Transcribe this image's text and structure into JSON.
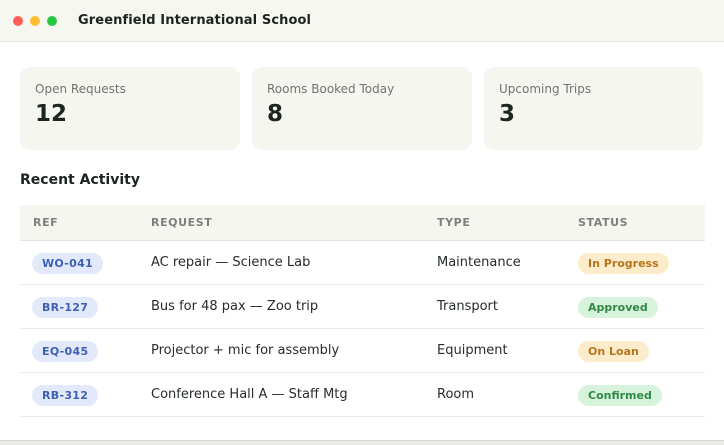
{
  "window": {
    "title": "Greenfield International School"
  },
  "stats": [
    {
      "label": "Open Requests",
      "value": "12"
    },
    {
      "label": "Rooms Booked Today",
      "value": "8"
    },
    {
      "label": "Upcoming Trips",
      "value": "3"
    }
  ],
  "section": {
    "title": "Recent Activity"
  },
  "table": {
    "headers": {
      "ref": "REF",
      "request": "REQUEST",
      "type": "TYPE",
      "status": "STATUS"
    },
    "rows": [
      {
        "ref": "WO-041",
        "request": "AC repair — Science Lab",
        "type": "Maintenance",
        "status": "In Progress"
      },
      {
        "ref": "BR-127",
        "request": "Bus for 48 pax — Zoo trip",
        "type": "Transport",
        "status": "Approved"
      },
      {
        "ref": "EQ-045",
        "request": "Projector + mic for assembly",
        "type": "Equipment",
        "status": "On Loan"
      },
      {
        "ref": "RB-312",
        "request": "Conference Hall A — Staff Mtg",
        "type": "Room",
        "status": "Confirmed"
      }
    ]
  },
  "colors": {
    "in_progress": {
      "bg": "#fdeccb",
      "fg": "#b7751d"
    },
    "approved": {
      "bg": "#d8f3dc",
      "fg": "#2f8a46"
    },
    "on_loan": {
      "bg": "#fdeccb",
      "fg": "#b7751d"
    },
    "confirmed": {
      "bg": "#d8f3dc",
      "fg": "#2f8a46"
    }
  }
}
